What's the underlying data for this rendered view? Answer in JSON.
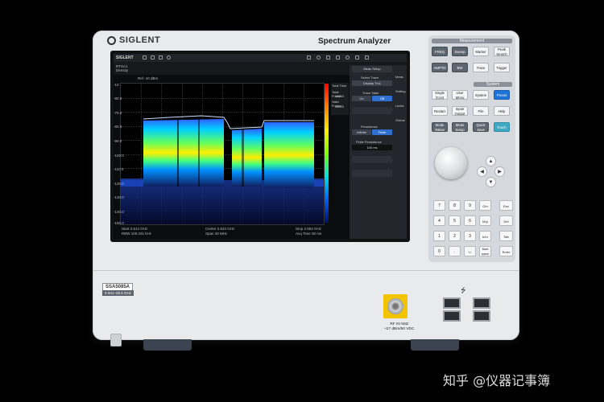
{
  "device": {
    "brand": "SIGLENT",
    "product_name": "Spectrum Analyzer",
    "model": "SSA5085A",
    "freq_range": "9 kHz–26.5 GHz",
    "rf_input": {
      "line1": "RF IN 50Ω",
      "line2": "+27 dBm/50 VDC"
    }
  },
  "screen": {
    "brand": "SIGLENT",
    "info_left": "RTSA1\nDensity",
    "ref": "Ref -10 dBm",
    "y_ticks": [
      "-10",
      "-80.0",
      "-70.0",
      "-80.0",
      "-90.0",
      "-100.0",
      "-110.0",
      "-120.0",
      "-130.0",
      "-140.0",
      "-150.0"
    ],
    "status": {
      "start": "Start 2.614 GHz",
      "center": "Center 2.634 GHz",
      "stop": "Stop 2.654 GHz",
      "rbw": "RBW 100.431 kHz",
      "span": "Span 40 MHz",
      "acq": "Acq Time 30 ms"
    },
    "side_menu": {
      "title": "Meas Setup",
      "select_trace_label": "Select Trace",
      "select_trace_value": "Display Trc1",
      "trace_state_label": "Trace State",
      "on": "On",
      "off": "Off",
      "persistence_label": "Persistence",
      "infinite": "Infinite",
      "finite": "Finite",
      "finite_persistence_label": "Finite Persistence",
      "finite_persistence_value": "100 ms",
      "tabs": [
        "Meas",
        "Setting",
        "Limits",
        "Global"
      ]
    },
    "total_info": {
      "total_time": "Total Time",
      "total_frame": "Total Frame:",
      "valid_frame": "Valid Frame:",
      "frame_value": "11653"
    }
  },
  "keypad": {
    "measurement_header": "Measurement",
    "system_header": "System",
    "meas_keys": [
      "FREQ",
      "Sweep",
      "Marker",
      "Peak Search",
      "AMPTD",
      "BW",
      "Trace",
      "Trigger"
    ],
    "sys_keys": [
      "Single /Cont",
      "User Menu",
      "System",
      "Preset",
      "Restart",
      "Input/ Output",
      "File",
      "Help",
      "Mode /Meas",
      "Meas Setup",
      "Quick Save",
      "Touch"
    ],
    "num_keys": [
      "7",
      "8",
      "9",
      "G/n",
      "4",
      "5",
      "6",
      "M/μ",
      "1",
      "2",
      "3",
      "k/m",
      "0",
      ".",
      "+/-",
      "Back space"
    ],
    "side_keys": [
      "Esc",
      "Del",
      "Tab",
      "Enter"
    ]
  },
  "watermark": "知乎 @仪器记事簿"
}
